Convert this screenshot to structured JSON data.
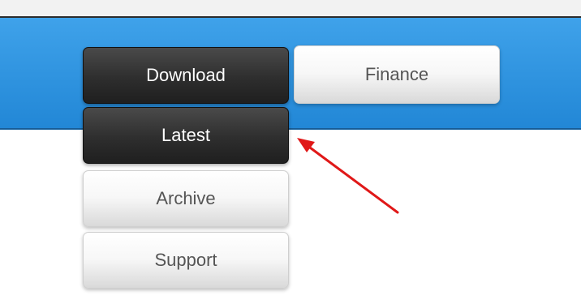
{
  "nav": {
    "download_label": "Download",
    "finance_label": "Finance"
  },
  "dropdown": {
    "items": [
      {
        "label": "Latest",
        "active": true
      },
      {
        "label": "Archive",
        "active": false
      },
      {
        "label": "Support",
        "active": false
      }
    ]
  },
  "colors": {
    "nav_bar": "#2f95e2",
    "dark_button": "#2e2e2e",
    "light_button": "#efefef",
    "arrow": "#e01818"
  },
  "annotation": {
    "icon": "red-arrow-icon"
  }
}
